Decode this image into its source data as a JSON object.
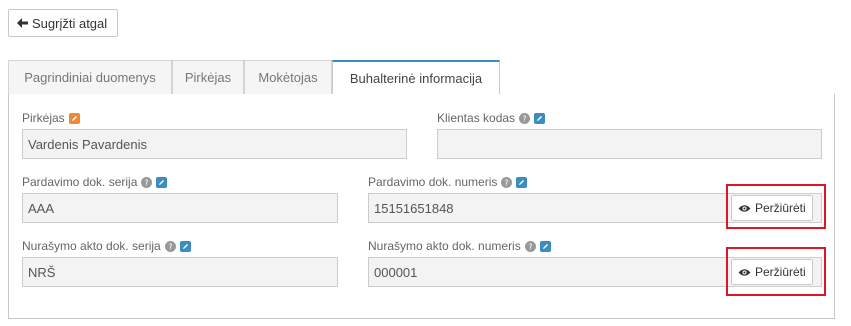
{
  "back_button": {
    "label": "Sugrįžti atgal",
    "icon": "arrow-left-icon"
  },
  "tabs": [
    {
      "label": "Pagrindiniai duomenys",
      "active": false
    },
    {
      "label": "Pirkėjas",
      "active": false
    },
    {
      "label": "Mokėtojas",
      "active": false
    },
    {
      "label": "Buhalterinė informacija",
      "active": true
    }
  ],
  "form": {
    "buyer": {
      "label": "Pirkėjas",
      "value": "Vardenis Pavardenis"
    },
    "client_code": {
      "label": "Klientas kodas",
      "value": ""
    },
    "sale_series": {
      "label": "Pardavimo dok. serija",
      "value": "AAA"
    },
    "sale_number": {
      "label": "Pardavimo dok. numeris",
      "value": "15151651848",
      "button": "Peržiūrėti"
    },
    "writeoff_series": {
      "label": "Nurašymo akto dok. serija",
      "value": "NRŠ"
    },
    "writeoff_number": {
      "label": "Nurašymo akto dok. numeris",
      "value": "000001",
      "button": "Peržiūrėti"
    }
  },
  "colors": {
    "accent": "#3c8dbc",
    "highlight": "#e0142b",
    "edit_orange": "#f0883a",
    "edit_blue": "#3c8dbc"
  }
}
